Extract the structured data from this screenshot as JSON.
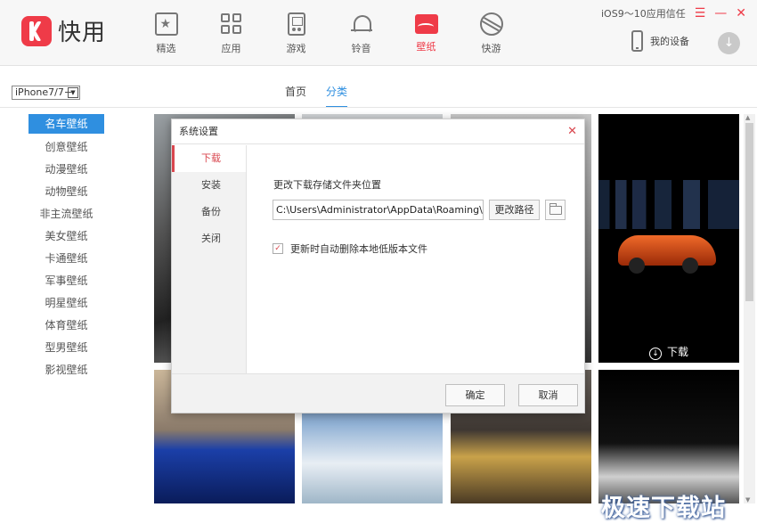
{
  "app": {
    "logo_text": "快用"
  },
  "nav": [
    {
      "label": "精选",
      "icon": "star-icon"
    },
    {
      "label": "应用",
      "icon": "apps-icon"
    },
    {
      "label": "游戏",
      "icon": "gamepad-icon"
    },
    {
      "label": "铃音",
      "icon": "bell-icon"
    },
    {
      "label": "壁纸",
      "icon": "wallpaper-icon",
      "active": true
    },
    {
      "label": "快游",
      "icon": "fast-game-icon"
    }
  ],
  "titlebar": {
    "trust_text": "iOS9～10应用信任",
    "menu": "☰",
    "minimize": "—",
    "close": "✕"
  },
  "device": {
    "label": "我的设备",
    "download_arrow": "↓"
  },
  "device_select": {
    "value": "iPhone7/7+",
    "arrow": "▼"
  },
  "tabs": [
    {
      "label": "首页"
    },
    {
      "label": "分类",
      "active": true
    }
  ],
  "categories": [
    "名车壁纸",
    "创意壁纸",
    "动漫壁纸",
    "动物壁纸",
    "非主流壁纸",
    "美女壁纸",
    "卡通壁纸",
    "军事壁纸",
    "明星壁纸",
    "体育壁纸",
    "型男壁纸",
    "影视壁纸"
  ],
  "tile_download": {
    "arrow": "↓",
    "label": "下载"
  },
  "scroll": {
    "up": "▲",
    "down": "▼"
  },
  "watermark": "极速下载站",
  "dialog": {
    "title": "系统设置",
    "close": "✕",
    "side_items": [
      "下载",
      "安装",
      "备份",
      "关闭"
    ],
    "path_label": "更改下载存储文件夹位置",
    "path_value": "C:\\Users\\Administrator\\AppData\\Roaming\\kua",
    "change_button": "更改路径",
    "check_mark": "✓",
    "checkbox_label": "更新时自动删除本地低版本文件",
    "ok": "确定",
    "cancel": "取消"
  },
  "colors": {
    "accent": "#ef3b48",
    "link_blue": "#2f8fe0"
  }
}
